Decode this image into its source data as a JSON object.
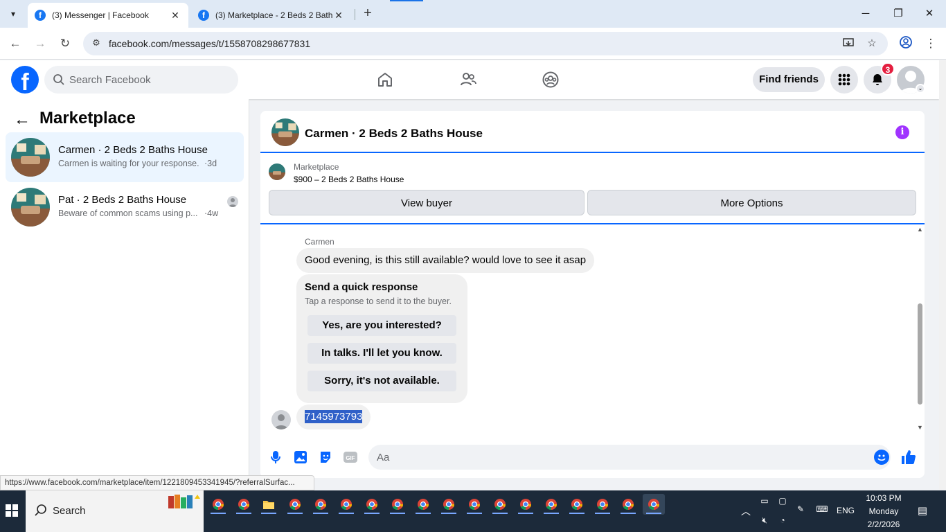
{
  "browser": {
    "tabs": [
      {
        "title": "(3) Messenger | Facebook",
        "active": true
      },
      {
        "title": "(3) Marketplace - 2 Beds 2 Baths",
        "active": false
      }
    ],
    "url": "facebook.com/messages/t/1558708298677831",
    "new_tab_symbol": "+",
    "window_controls": {
      "minimize": "─",
      "maximize": "❐",
      "close": "✕"
    }
  },
  "header": {
    "search_placeholder": "Search Facebook",
    "find_friends_label": "Find friends",
    "notification_count": "3",
    "icons": [
      "home-icon",
      "friends-icon",
      "groups-icon",
      "menu-grid-icon",
      "bell-icon",
      "avatar-icon"
    ]
  },
  "sidebar": {
    "title": "Marketplace",
    "conversations": [
      {
        "name": "Carmen · 2 Beds 2 Baths House",
        "preview": "Carmen is waiting for your response.",
        "time": "·3d",
        "active": true
      },
      {
        "name": "Pat · 2 Beds 2 Baths House",
        "preview": "Beware of common scams using p...",
        "time": "·4w",
        "active": false
      }
    ]
  },
  "chat": {
    "title": "Carmen · 2 Beds 2 Baths House",
    "listing": {
      "source": "Marketplace",
      "price_title": "$900 – 2 Beds 2 Baths House",
      "view_buyer_label": "View buyer",
      "more_options_label": "More Options"
    },
    "messages": {
      "author": "Carmen",
      "text": "Good evening, is this still available?  would love to see it asap",
      "quick_response": {
        "title": "Send a quick response",
        "subtitle": "Tap a response to send it to the buyer.",
        "options": [
          "Yes, are you interested?",
          "In talks. I'll let you know.",
          "Sorry, it's not available."
        ]
      },
      "my_message": "7145973793"
    },
    "composer": {
      "placeholder": "Aa"
    }
  },
  "status_bar_url": "https://www.facebook.com/marketplace/item/1221809453341945/?referralSurfac...",
  "taskbar": {
    "search_label": "Search",
    "language": "ENG",
    "time": "10:03 PM",
    "day": "Monday",
    "date": "2/2/2026"
  },
  "colors": {
    "fb_blue": "#0866ff",
    "active_conv_bg": "#ebf5ff",
    "badge_red": "#e41e3f",
    "info_purple": "#a033ff",
    "selection": "#2f60c8",
    "taskbar_bg": "#1c2a3a"
  }
}
